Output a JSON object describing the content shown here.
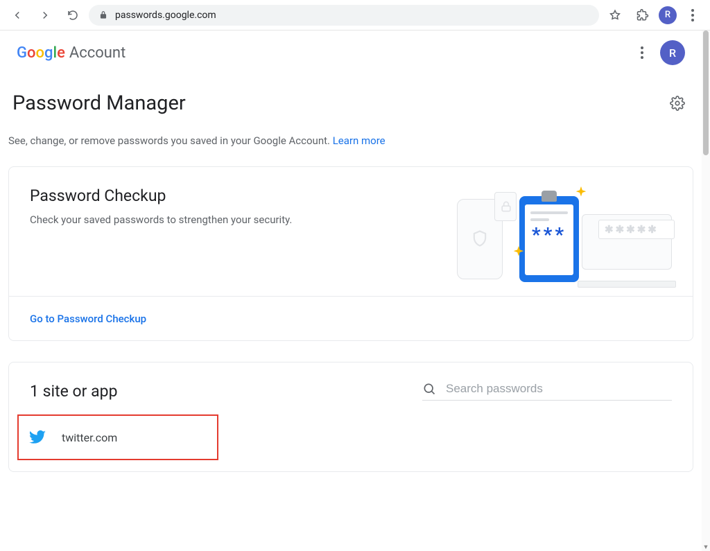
{
  "browser": {
    "url": "passwords.google.com",
    "avatar_initial": "R"
  },
  "header": {
    "logo_product": "Account",
    "avatar_initial": "R"
  },
  "page": {
    "title": "Password Manager",
    "description": "See, change, or remove passwords you saved in your Google Account. ",
    "learn_more": "Learn more"
  },
  "checkup": {
    "title": "Password Checkup",
    "subtitle": "Check your saved passwords to strengthen your security.",
    "cta": "Go to Password Checkup"
  },
  "sites": {
    "count_label": "1 site or app",
    "search_placeholder": "Search passwords",
    "items": [
      {
        "name": "twitter.com",
        "icon": "twitter"
      }
    ]
  }
}
